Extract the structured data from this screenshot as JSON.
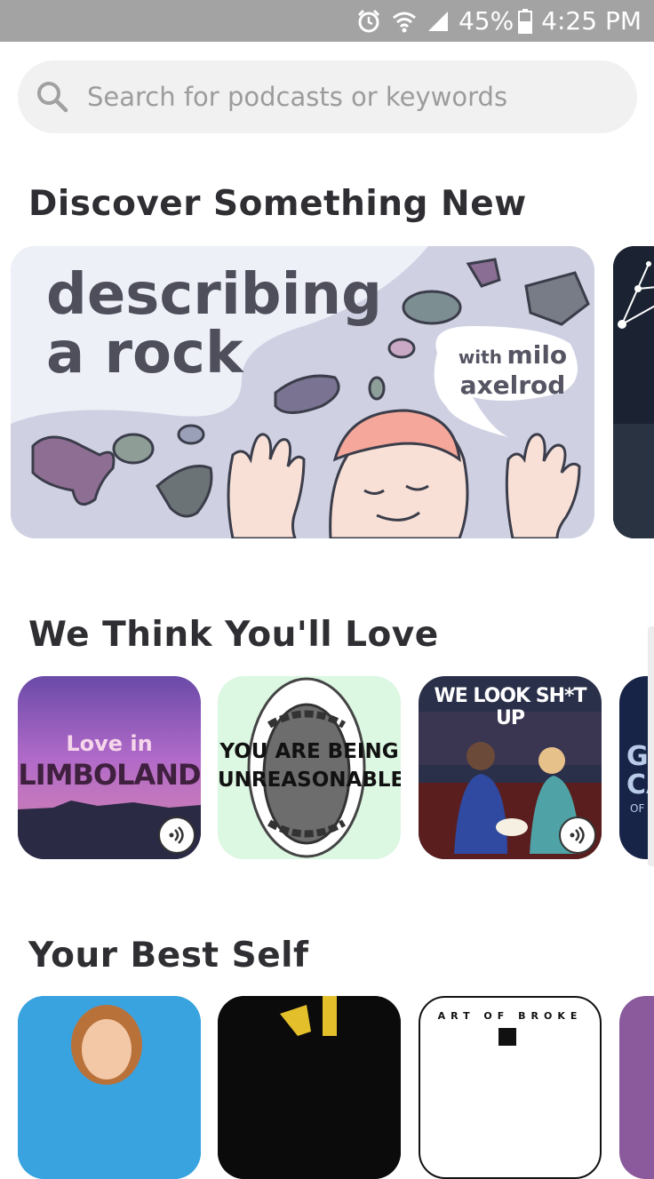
{
  "status_bar": {
    "battery": "45%",
    "time": "4:25 PM",
    "icons": [
      "alarm-icon",
      "wifi-icon",
      "signal-icon",
      "battery-icon"
    ]
  },
  "search": {
    "placeholder": "Search for podcasts or keywords",
    "icon": "search-icon"
  },
  "sections": [
    {
      "title": "Discover Something New"
    },
    {
      "title": "We Think You'll Love"
    },
    {
      "title": "Your Best Self"
    }
  ],
  "hero": {
    "title_line1": "describing",
    "title_line2": "a rock",
    "bubble_with": "with",
    "bubble_name_line1": "milo",
    "bubble_name_line2": "axelrod"
  },
  "recommended": [
    {
      "line1": "Love in",
      "line2": "LIMBOLAND",
      "badge": "anchor-icon"
    },
    {
      "line1": "YOU ARE BEING",
      "line2": "UNREASONABLE"
    },
    {
      "line1": "WE LOOK SH*T UP",
      "badge": "anchor-icon"
    },
    {
      "line1": "GI",
      "line2": "CA",
      "line3": "OF"
    }
  ],
  "best_self": [
    {
      "label": ""
    },
    {
      "label": ""
    },
    {
      "label": "ART OF BROKE"
    },
    {
      "label": ""
    }
  ],
  "colors": {
    "status_bar": "#a3a3a3",
    "search_bg": "#f1f1f1",
    "title_text": "#2f2f33",
    "hero_bg": "#dfe0ea"
  }
}
